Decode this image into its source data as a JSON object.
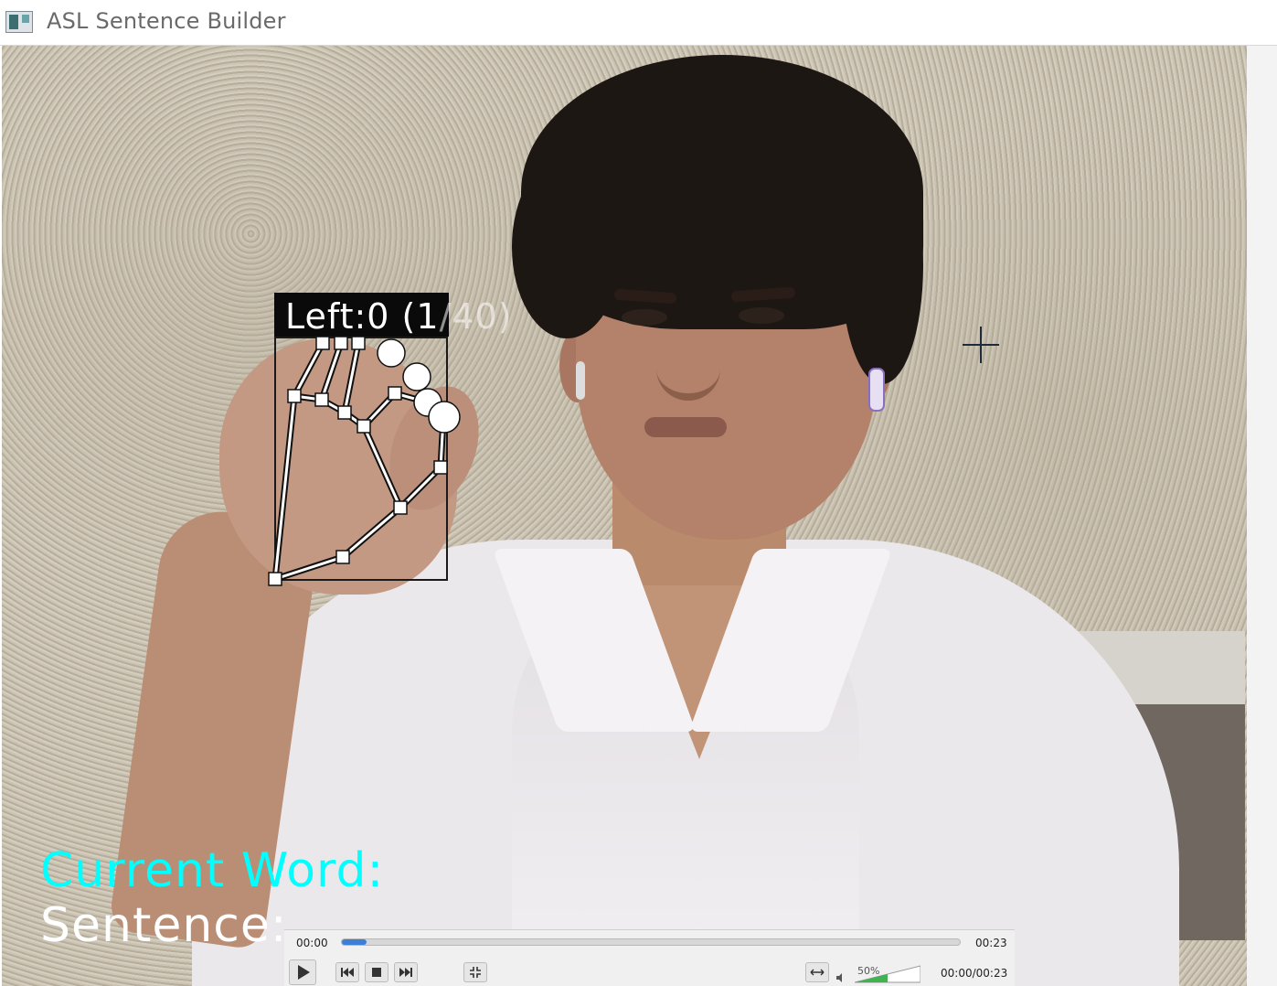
{
  "window": {
    "title": "ASL Sentence Builder",
    "icon": "app-icon"
  },
  "video": {
    "hand_label_main": "Left:0 (1",
    "hand_label_faded": "/40)",
    "current_word_label": "Current Word:",
    "sentence_label": "Sentence:",
    "colors": {
      "current_word": "#00ffff",
      "sentence": "#ffffff",
      "hand_label_bg": "#000000"
    }
  },
  "player": {
    "elapsed": "00:00",
    "duration": "00:23",
    "position_display": "00:00/00:23",
    "progress": 0.04,
    "volume_label": "50%",
    "volume": 0.5,
    "buttons": [
      "play-icon",
      "skip-back-icon",
      "stop-icon",
      "skip-forward-icon",
      "fullscreen-icon",
      "fit-width-icon",
      "volume-icon"
    ],
    "accent": "#3d7fd6"
  }
}
